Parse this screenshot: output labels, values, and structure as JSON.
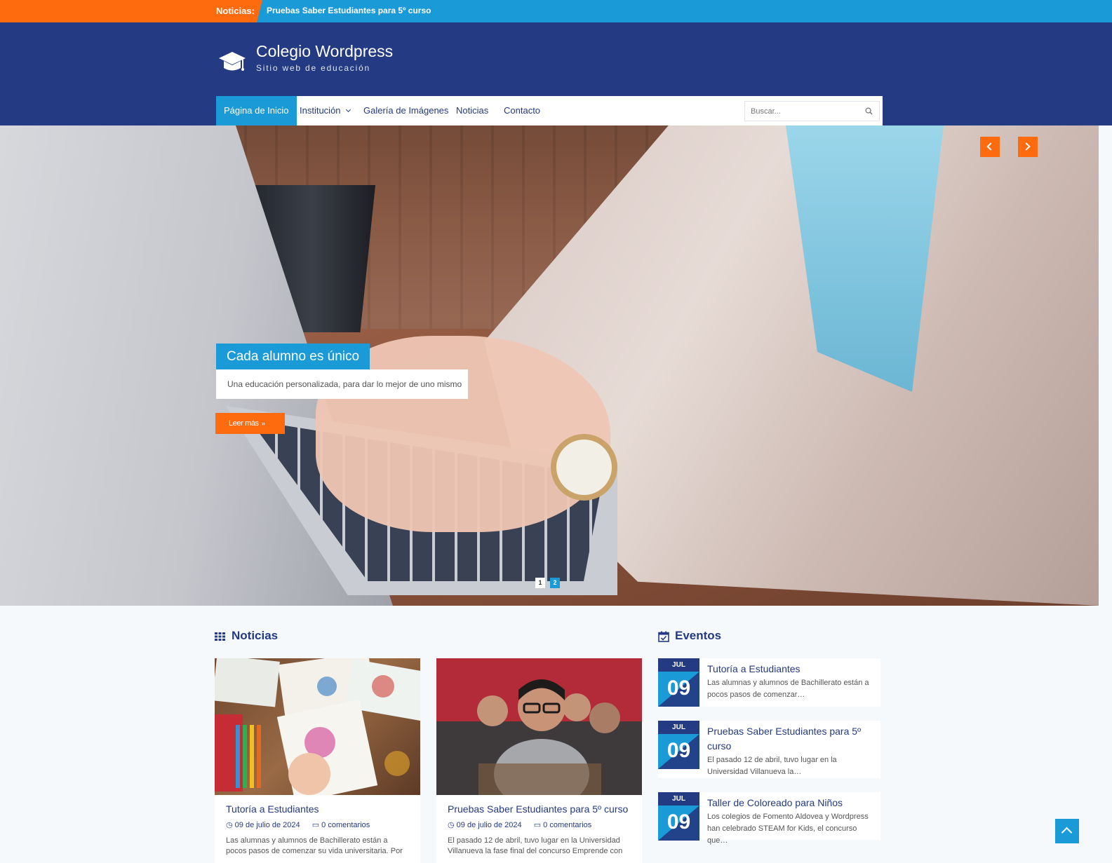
{
  "ticker": {
    "label": "Noticias:",
    "text": "Pruebas Saber Estudiantes para 5º curso"
  },
  "site": {
    "title": "Colegio Wordpress",
    "tagline": "Sitio web de educación",
    "logo_icon": "graduation-cap-icon"
  },
  "nav": {
    "items": [
      {
        "label": "Página de Inicio",
        "active": true
      },
      {
        "label": "Institución",
        "has_dropdown": true
      },
      {
        "label": "Galería de Imágenes"
      },
      {
        "label": "Noticias"
      },
      {
        "label": "Contacto"
      }
    ],
    "search_placeholder": "Buscar..."
  },
  "slider": {
    "title": "Cada alumno es único",
    "description": "Una educación personalizada, para dar lo mejor de uno mismo",
    "button_label": "Leer más",
    "button_glyph": "»",
    "pages": [
      "1",
      "2"
    ],
    "active_page": "2"
  },
  "news": {
    "section_title": "Noticias",
    "items": [
      {
        "title": "Tutoría a Estudiantes",
        "date": "09 de julio de 2024",
        "comments": "0 comentarios",
        "excerpt": "Las alumnas y alumnos de Bachillerato están a pocos pasos de comenzar su vida universitaria. Por"
      },
      {
        "title": "Pruebas Saber Estudiantes para 5º curso",
        "date": "09 de julio de 2024",
        "comments": "0 comentarios",
        "excerpt": "El pasado 12 de abril, tuvo lugar en la Universidad Villanueva la fase final del concurso Emprende con"
      }
    ]
  },
  "events": {
    "section_title": "Eventos",
    "items": [
      {
        "month": "JUL",
        "day": "09",
        "title": "Tutoría a Estudiantes",
        "excerpt": "Las alumnas y alumnos de Bachillerato están a pocos pasos de comenzar…"
      },
      {
        "month": "JUL",
        "day": "09",
        "title": "Pruebas Saber Estudiantes para 5º curso",
        "excerpt": "El pasado 12 de abril, tuvo lugar en la Universidad Villanueva la…"
      },
      {
        "month": "JUL",
        "day": "09",
        "title": "Taller de Coloreado para Niños",
        "excerpt": "Los colegios de Fomento Aldovea y Wordpress han celebrado STEAM for Kids, el concurso que…"
      }
    ]
  },
  "colors": {
    "primary_blue": "#243a82",
    "accent_cyan": "#1a9ad6",
    "accent_orange": "#fe6a0e"
  }
}
